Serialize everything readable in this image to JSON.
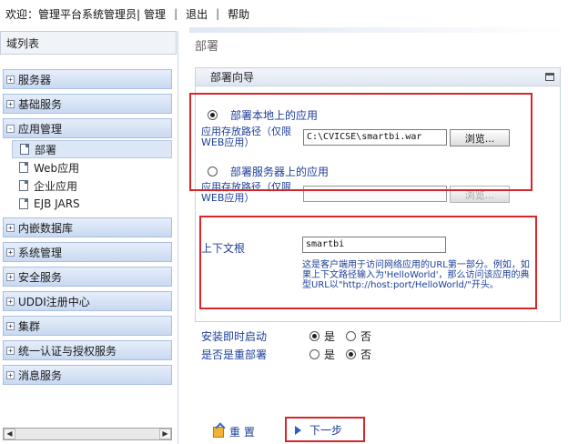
{
  "topbar": {
    "welcome": "欢迎：管理平台系统管理员|",
    "manage": "管理",
    "sep1": "|",
    "logout": "退出",
    "sep2": "|",
    "help": "帮助"
  },
  "sidebar": {
    "domain_list": "域列表",
    "items": [
      {
        "label": "服务器",
        "toggle": "+"
      },
      {
        "label": "基础服务",
        "toggle": "+"
      },
      {
        "label": "应用管理",
        "toggle": "-"
      },
      {
        "label": "内嵌数据库",
        "toggle": "+"
      },
      {
        "label": "系统管理",
        "toggle": "+"
      },
      {
        "label": "安全服务",
        "toggle": "+"
      },
      {
        "label": "UDDI注册中心",
        "toggle": "+"
      },
      {
        "label": "集群",
        "toggle": "+"
      },
      {
        "label": "统一认证与授权服务",
        "toggle": "+"
      },
      {
        "label": "消息服务",
        "toggle": "+"
      }
    ],
    "sub_items": [
      "部署",
      "Web应用",
      "企业应用",
      "EJB JARS"
    ],
    "scroll_left": "◀",
    "scroll_right": "▶"
  },
  "main": {
    "page_title": "部署",
    "wizard_title": "部署向导",
    "radio_local": "部署本地上的应用",
    "path_label_1": "应用存放路径（仅限WEB应用）",
    "path_value": "C:\\CVICSE\\smartbi.war",
    "browse": "浏览...",
    "radio_server": "部署服务器上的应用",
    "path_label_2": "应用存放路径（仅限WEB应用）",
    "path_value_2": "",
    "context_label": "上下文根",
    "context_value": "smartbi",
    "hint": "这是客户端用于访问网络应用的URL第一部分。例如，如果上下文路径输入为'HelloWorld'，那么访问该应用的典型URL以\"http://host:port/HelloWorld/\"开头。",
    "start_label": "安装即时启动",
    "redeploy_label": "是否是重部署",
    "yes": "是",
    "no": "否",
    "reset": "重 置",
    "next": "下一步"
  },
  "colors": {
    "highlight": "#d8262a",
    "nav_bg": "#c9d9f1",
    "label_blue": "#1d3f99"
  }
}
